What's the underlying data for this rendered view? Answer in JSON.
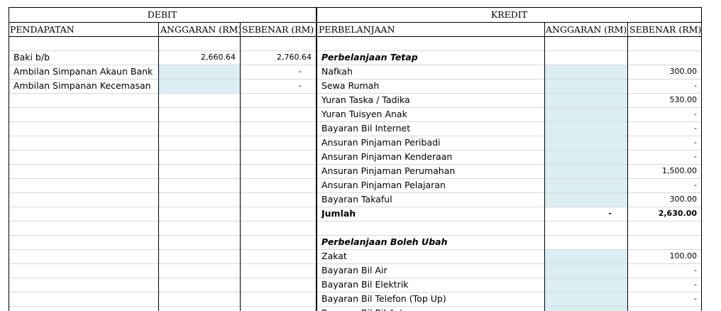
{
  "debit": {
    "header": "DEBIT",
    "col_pendapatan": "PENDAPATAN",
    "col_anggaran": "ANGGARAN (RM)",
    "col_sebenar": "SEBENAR (RM)",
    "rows": [
      {
        "label": "Baki b/b",
        "anggaran": "2,660.64",
        "sebenar": "2,760.64"
      },
      {
        "label": "Ambilan Simpanan Akaun Bank",
        "anggaran": "",
        "sebenar": "-"
      },
      {
        "label": "Ambilan Simpanan Kecemasan",
        "anggaran": "",
        "sebenar": "-"
      }
    ]
  },
  "kredit": {
    "header": "KREDIT",
    "col_perbelanjaan": "PERBELANJAAN",
    "col_anggaran": "ANGGARAN (RM)",
    "col_sebenar": "SEBENAR (RM)",
    "section_tetap": "Perbelanjaan Tetap",
    "tetap_rows": [
      {
        "label": "Nafkah",
        "sebenar": "300.00"
      },
      {
        "label": "Sewa Rumah",
        "sebenar": "-"
      },
      {
        "label": "Yuran Taska / Tadika",
        "sebenar": "530.00"
      },
      {
        "label": "Yuran Tuisyen Anak",
        "sebenar": "-"
      },
      {
        "label": "Bayaran Bil Internet",
        "sebenar": "-"
      },
      {
        "label": "Ansuran Pinjaman Peribadi",
        "sebenar": "-"
      },
      {
        "label": "Ansuran Pinjaman Kenderaan",
        "sebenar": "-"
      },
      {
        "label": "Ansuran Pinjaman Perumahan",
        "sebenar": "1,500.00"
      },
      {
        "label": "Ansuran Pinjaman Pelajaran",
        "sebenar": "-"
      },
      {
        "label": "Bayaran Takaful",
        "sebenar": "300.00"
      }
    ],
    "jumlah": {
      "label": "Jumlah",
      "anggaran": "-",
      "sebenar": "2,630.00"
    },
    "section_ubah": "Perbelanjaan Boleh Ubah",
    "ubah_rows": [
      {
        "label": "Zakat",
        "sebenar": "100.00"
      },
      {
        "label": "Bayaran Bil Air",
        "sebenar": "-"
      },
      {
        "label": "Bayaran Bil Elektrik",
        "sebenar": "-"
      },
      {
        "label": "Bayaran Bil Telefon (Top Up)",
        "sebenar": "-"
      },
      {
        "label": "Bayaran Bil Bil Astro",
        "sebenar": ""
      }
    ]
  },
  "colors": {
    "input_shade": "#daeef3",
    "grid": "#d9d9d9"
  }
}
